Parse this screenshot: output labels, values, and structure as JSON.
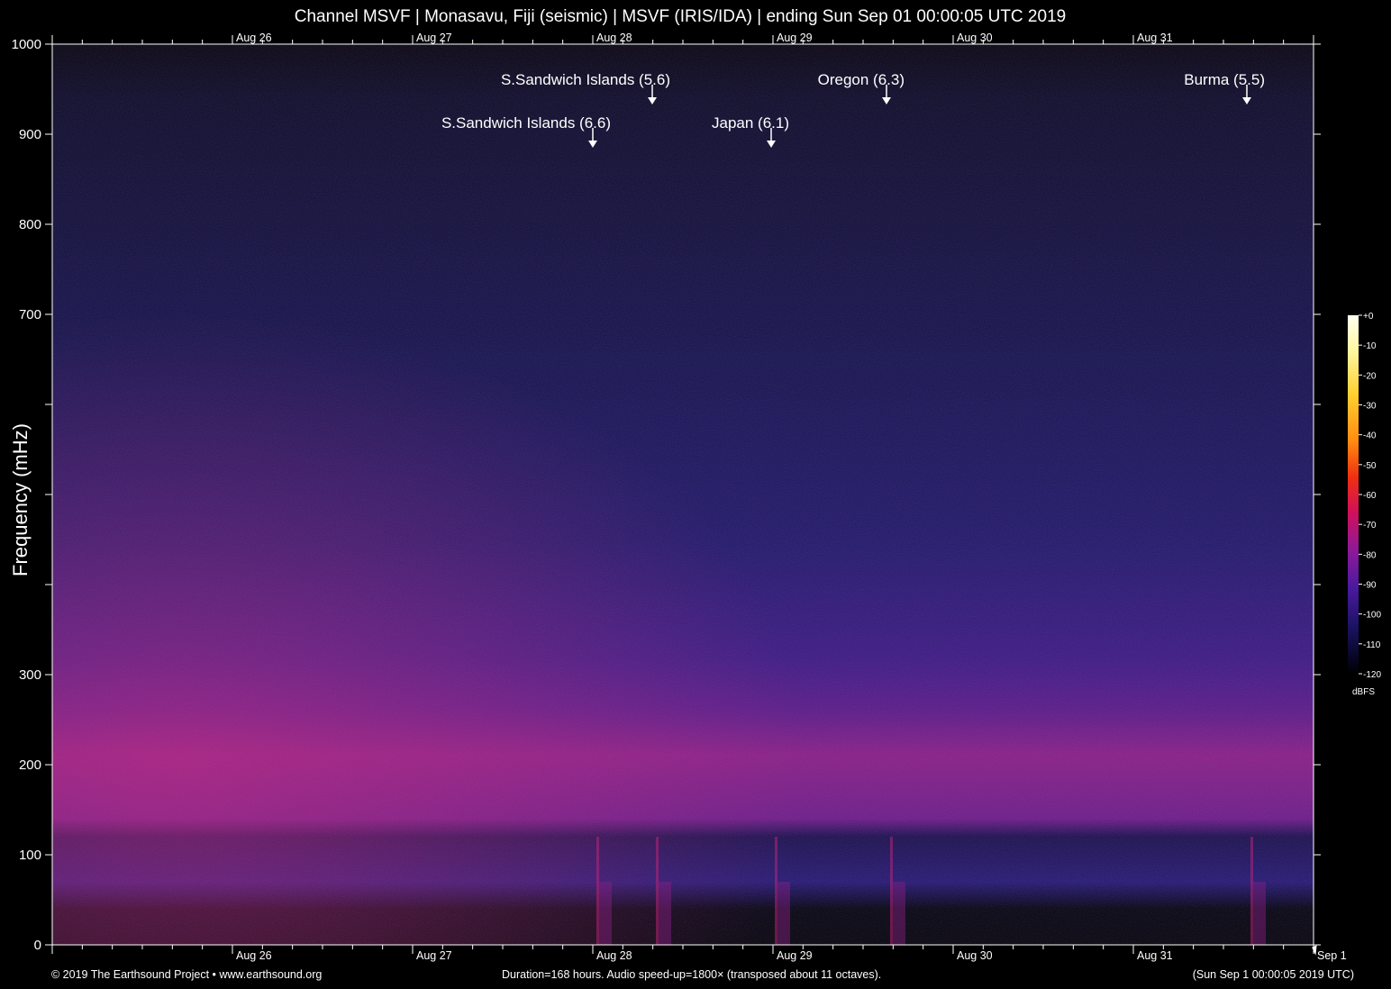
{
  "title": "Channel MSVF | Monasavu, Fiji (seismic) | MSVF (IRIS/IDA) | ending Sun Sep 01 00:00:05 UTC 2019",
  "footer": {
    "left": "© 2019 The Earthsound Project • www.earthsound.org",
    "center": "Duration=168 hours. Audio speed-up=1800× (transposed about 11 octaves).",
    "right": "(Sun Sep  1 00:00:05 2019 UTC)"
  },
  "colors": {
    "background": "#000000",
    "axis": "#ffffff",
    "noise_floor": "#1a1750",
    "band_peak": "#c4237a"
  },
  "chart_data": {
    "type": "heatmap",
    "title": "Channel MSVF | Monasavu, Fiji (seismic) | MSVF (IRIS/IDA) | ending Sun Sep 01 00:00:05 UTC 2019",
    "ylabel": "Frequency (mHz)",
    "xlabel": "",
    "ylim": [
      0,
      1000
    ],
    "xlim_days": [
      0,
      7
    ],
    "y_ticks": [
      0,
      100,
      200,
      300,
      400,
      500,
      600,
      700,
      800,
      900,
      1000
    ],
    "y_tick_labels": [
      "0",
      "100",
      "200",
      "300",
      "",
      "",
      "",
      "700",
      "800",
      "900",
      "1000"
    ],
    "x_tick_labels": [
      {
        "day": 1,
        "label": "Aug 26"
      },
      {
        "day": 2,
        "label": "Aug 27"
      },
      {
        "day": 3,
        "label": "Aug 28"
      },
      {
        "day": 4,
        "label": "Aug 29"
      },
      {
        "day": 5,
        "label": "Aug 30"
      },
      {
        "day": 6,
        "label": "Aug 31"
      },
      {
        "day": 7,
        "label": "Sep  1"
      }
    ],
    "top_x_tick_labels": [
      "Aug 26",
      "Aug 27",
      "Aug 28",
      "Aug 29",
      "Aug 30",
      "Aug 31"
    ],
    "events": [
      {
        "label": "S.Sandwich Islands (6.6)",
        "day": 3.0,
        "row": 2
      },
      {
        "label": "S.Sandwich Islands (5.6)",
        "day": 3.33,
        "row": 1
      },
      {
        "label": "Japan (6.1)",
        "day": 3.99,
        "row": 2
      },
      {
        "label": "Oregon (6.3)",
        "day": 4.63,
        "row": 1
      },
      {
        "label": "Burma (5.5)",
        "day": 6.63,
        "row": 1
      }
    ],
    "colorbar": {
      "unit": "dBFS",
      "range": [
        -120,
        0
      ],
      "ticks": [
        "+0",
        "-10",
        "-20",
        "-30",
        "-40",
        "-50",
        "-60",
        "-70",
        "-80",
        "-90",
        "-100",
        "-110",
        "-120"
      ]
    },
    "grid": false
  }
}
